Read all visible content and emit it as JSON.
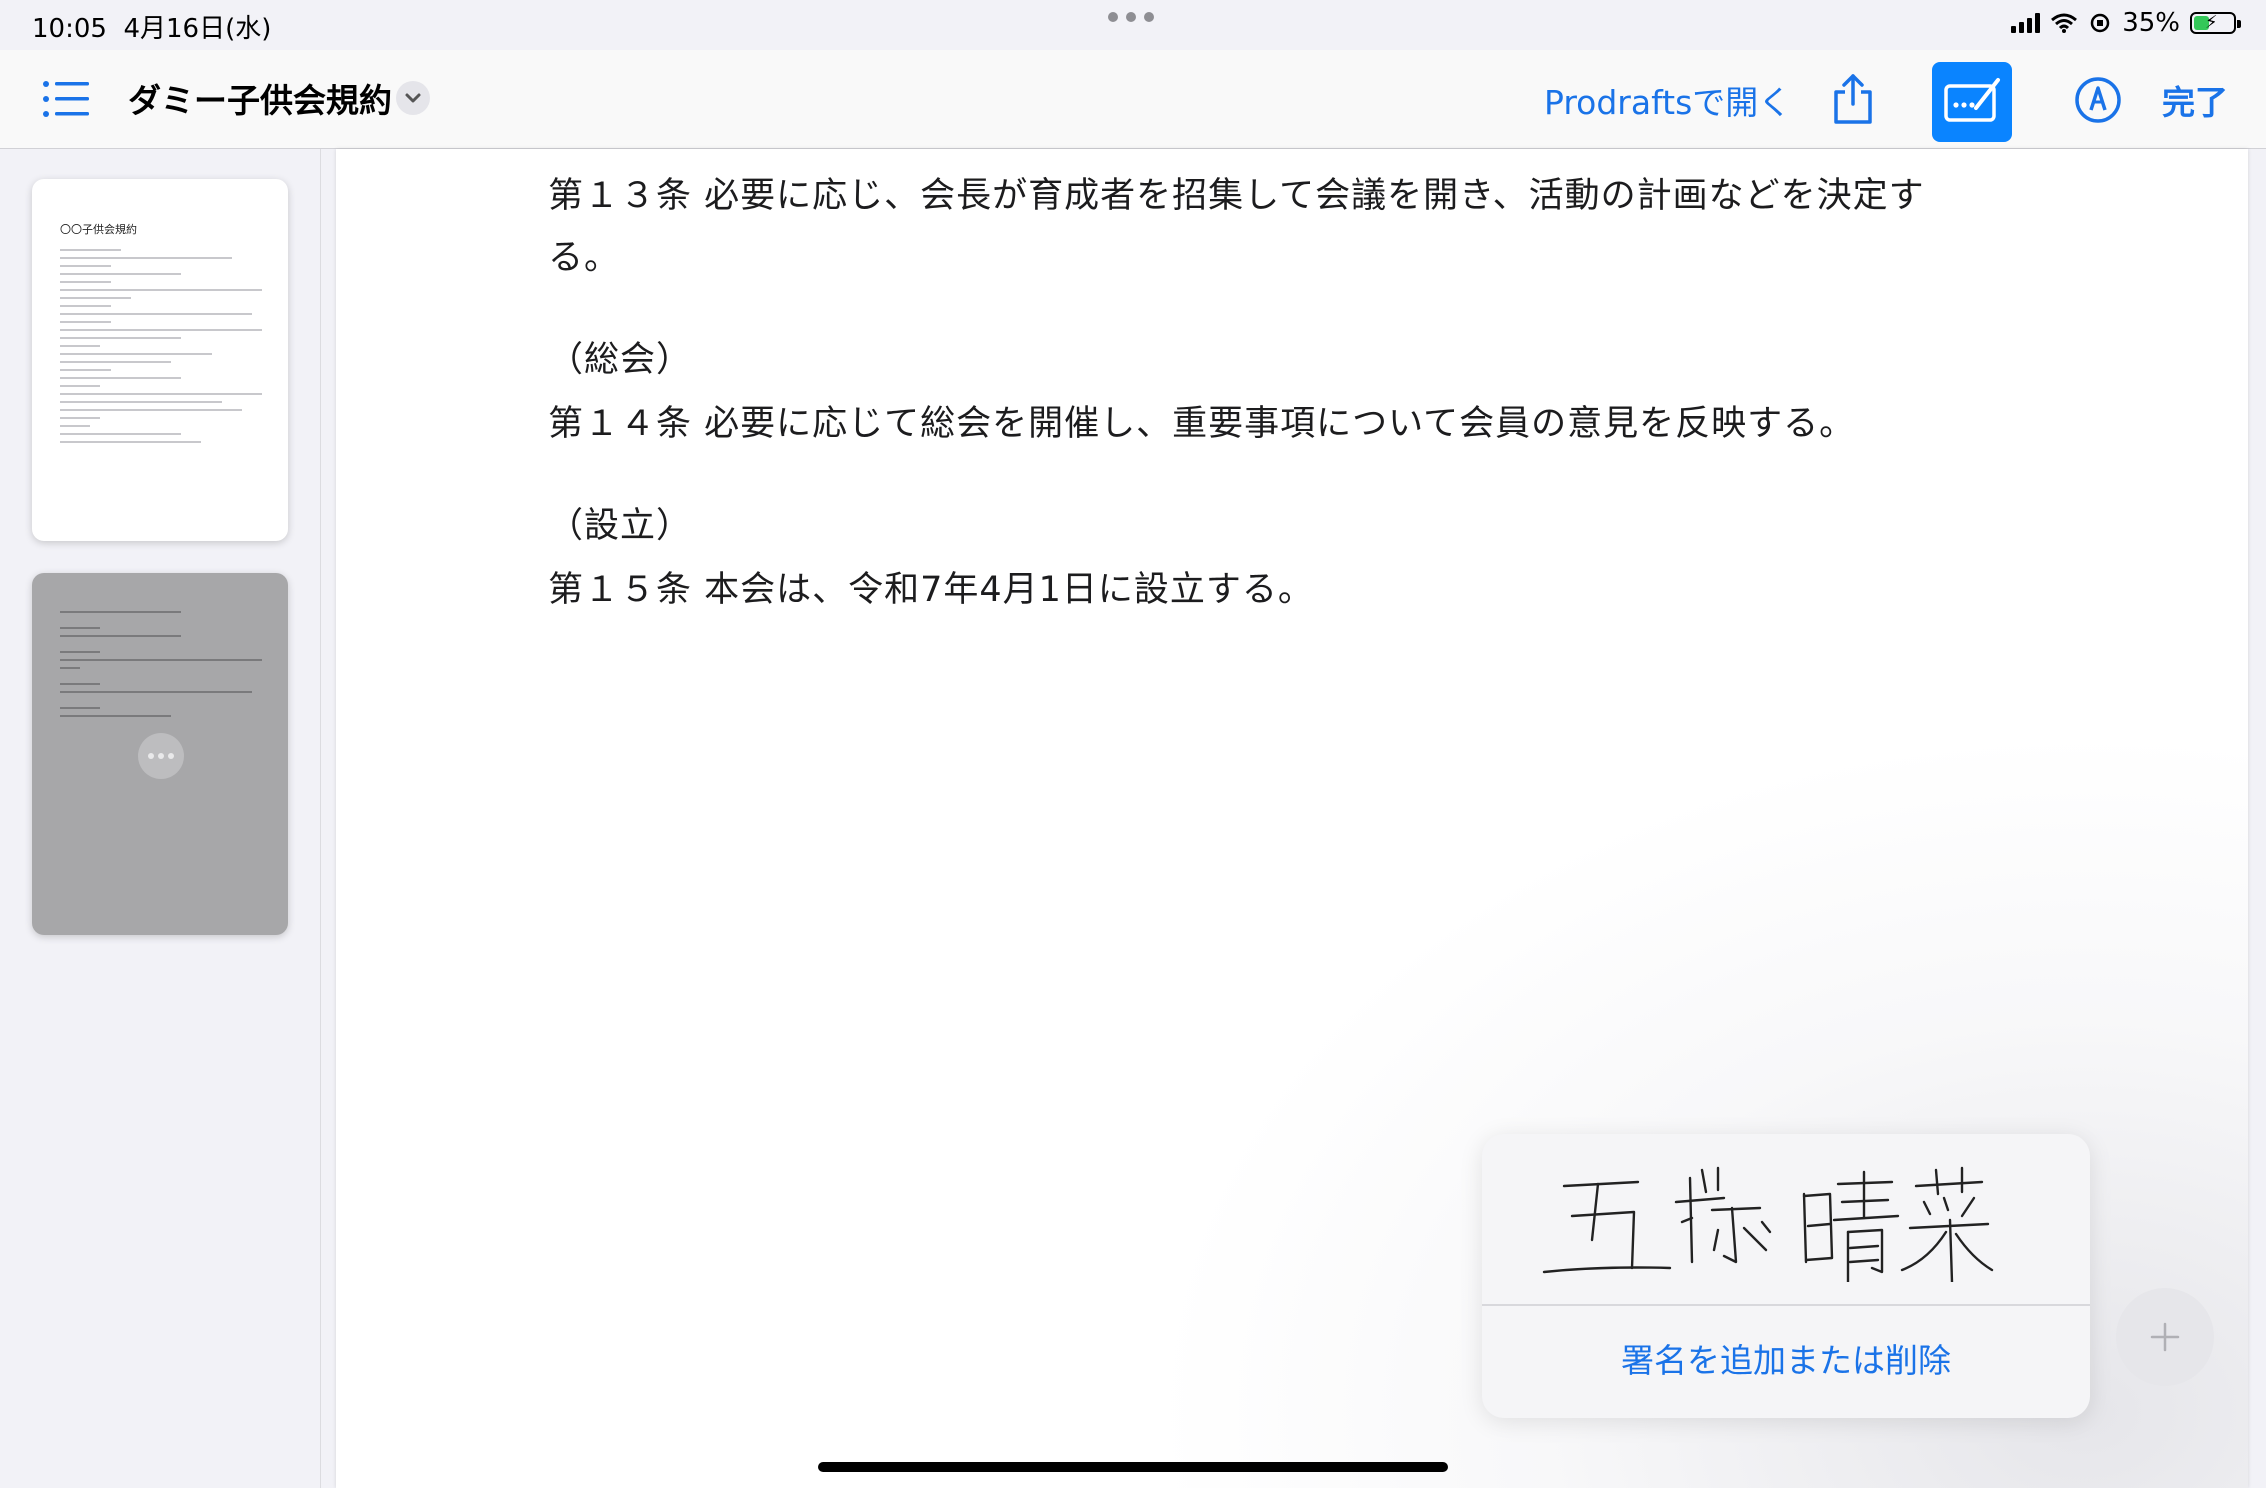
{
  "status_bar": {
    "time": "10:05",
    "date": "4月16日(水)",
    "battery": "35%"
  },
  "toolbar": {
    "document_title": "ダミー子供会規約",
    "open_in_label": "Prodraftsで開く",
    "done_label": "完了",
    "accent_color": "#1a73e8",
    "markup_active_color": "#0a84ff"
  },
  "sidebar": {
    "thumbnails": [
      {
        "title": "〇〇子供会規約"
      },
      {
        "title": ""
      }
    ]
  },
  "document": {
    "lines": [
      "第１３条 必要に応じ、会長が育成者を招集して会議を開き、活動の計画などを決定す",
      "る。",
      "（総会）",
      "第１４条 必要に応じて総会を開催し、重要事項について会員の意見を反映する。",
      "（設立）",
      "第１５条 本会は、令和7年4月1日に設立する。"
    ]
  },
  "signature_popover": {
    "signature_text": "五藤 晴菜",
    "action_label": "署名を追加または削除"
  },
  "icons": {
    "list": "list-icon",
    "share": "share-icon",
    "markup": "markup-icon",
    "pen": "pen-icon",
    "add": "plus-icon"
  }
}
